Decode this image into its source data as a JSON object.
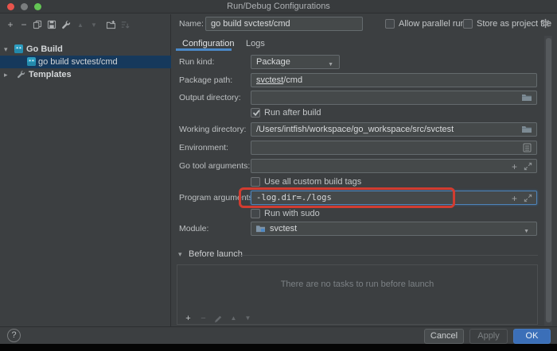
{
  "window": {
    "title": "Run/Debug Configurations"
  },
  "sidebar": {
    "tree": {
      "group_label": "Go Build",
      "selected_item_label": "go build svctest/cmd",
      "templates_label": "Templates"
    }
  },
  "header": {
    "name_label": "Name:",
    "name_value": "go build svctest/cmd",
    "allow_parallel_run_label": "Allow parallel run",
    "store_as_project_file_label": "Store as project file"
  },
  "tabs": {
    "configuration": "Configuration",
    "logs": "Logs"
  },
  "form": {
    "run_kind": {
      "label": "Run kind:",
      "value": "Package"
    },
    "package_path": {
      "label": "Package path:",
      "value_link": "svctest",
      "value_rest": "/cmd"
    },
    "output_directory": {
      "label": "Output directory:",
      "value": ""
    },
    "run_after_build": {
      "label": "Run after build",
      "checked": true
    },
    "working_directory": {
      "label": "Working directory:",
      "value": "/Users/intfish/workspace/go_workspace/src/svctest"
    },
    "environment": {
      "label": "Environment:",
      "value": ""
    },
    "go_tool_arguments": {
      "label": "Go tool arguments:",
      "value": ""
    },
    "use_all_custom_build_tags": {
      "label": "Use all custom build tags",
      "checked": false
    },
    "program_arguments": {
      "label": "Program arguments:",
      "value": "-log.dir=./logs"
    },
    "run_with_sudo": {
      "label": "Run with sudo",
      "checked": false
    },
    "module": {
      "label": "Module:",
      "value": "svctest"
    }
  },
  "before_launch": {
    "title": "Before launch",
    "empty_message": "There are no tasks to run before launch"
  },
  "footer": {
    "help": "?",
    "cancel": "Cancel",
    "apply": "Apply",
    "ok": "OK"
  },
  "glyphs": {
    "plus": "+",
    "minus": "−",
    "arrow_up": "▲",
    "arrow_down": "▼",
    "chevron_down": "▾",
    "chevron_right": "▸",
    "dropdown_arrow": "▼"
  },
  "colors": {
    "accent_blue": "#4a88c7",
    "tree_selection": "#16395c",
    "annotation_red": "#d13c30",
    "ok_button": "#3b6fb8",
    "go_icon_teal": "#2d9dc0"
  }
}
